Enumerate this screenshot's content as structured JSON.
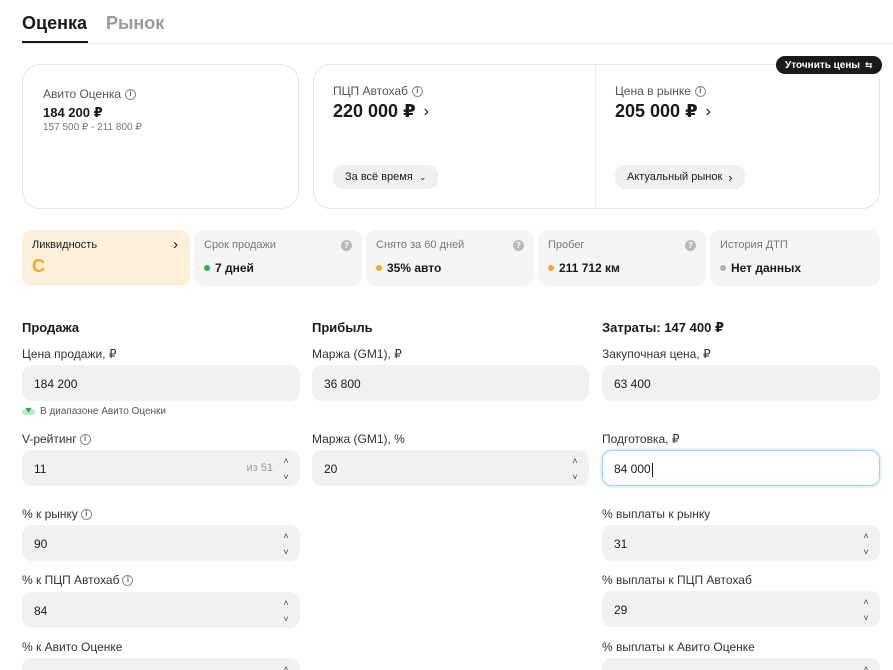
{
  "tabs": [
    {
      "label": "Оценка",
      "active": true
    },
    {
      "label": "Рынок",
      "active": false
    }
  ],
  "refine_button": {
    "label": "Уточнить цены",
    "icon": "sliders-icon"
  },
  "cards": {
    "avito": {
      "label": "Авито Оценка",
      "value": "184 200 ₽",
      "range": "157 500 ₽ - 211 800 ₽"
    },
    "pcp": {
      "label": "ПЦП Автохаб",
      "value": "220 000 ₽",
      "filter": "За всё время"
    },
    "market": {
      "label": "Цена в рынке",
      "value": "205 000 ₽",
      "filter": "Актуальный рынок"
    }
  },
  "metrics": [
    {
      "label": "Ликвидность",
      "value": "C",
      "has_chevron": true
    },
    {
      "label": "Срок продажи",
      "value": "7 дней",
      "dot_color": "#22b14c"
    },
    {
      "label": "Снято за 60 дней",
      "value": "35% авто",
      "dot_color": "#f5a623"
    },
    {
      "label": "Пробег",
      "value": "211 712 км",
      "dot_color": "#f5a623"
    },
    {
      "label": "История ДТП",
      "value": "Нет данных",
      "dot_color": "#b0b0b0"
    }
  ],
  "sale": {
    "title": "Продажа",
    "price_label": "Цена продажи, ₽",
    "price_value": "184 200",
    "hint": "В диапазоне Авито Оценки",
    "vrating_label": "V-рейтинг",
    "vrating_value": "11",
    "vrating_suffix": "из 51",
    "market_pct_label": "% к рынку",
    "market_pct_value": "90",
    "pcp_pct_label": "% к ПЦП Автохаб",
    "pcp_pct_value": "84",
    "avito_pct_label": "% к Авито Оценке"
  },
  "profit": {
    "title": "Прибыль",
    "margin_rub_label": "Маржа (GM1), ₽",
    "margin_rub_value": "36 800",
    "margin_pct_label": "Маржа (GM1), %",
    "margin_pct_value": "20"
  },
  "costs": {
    "title": "Затраты: 147 400 ₽",
    "purchase_label": "Закупочная цена, ₽",
    "purchase_value": "63 400",
    "prep_label": "Подготовка, ₽",
    "prep_value": "84 000",
    "payout_market_label": "% выплаты к рынку",
    "payout_market_value": "31",
    "payout_pcp_label": "% выплаты к ПЦП Автохаб",
    "payout_pcp_value": "29",
    "payout_avito_label": "% выплаты к Авито Оценке"
  },
  "colors": {
    "accent_dark": "#1a1a1a",
    "liquidity_bg": "#fdf0da",
    "grade": "#f5a623",
    "good": "#22b14c",
    "warn": "#f5a623",
    "neutral": "#b0b0b0",
    "focus": "#9fd3f0"
  }
}
